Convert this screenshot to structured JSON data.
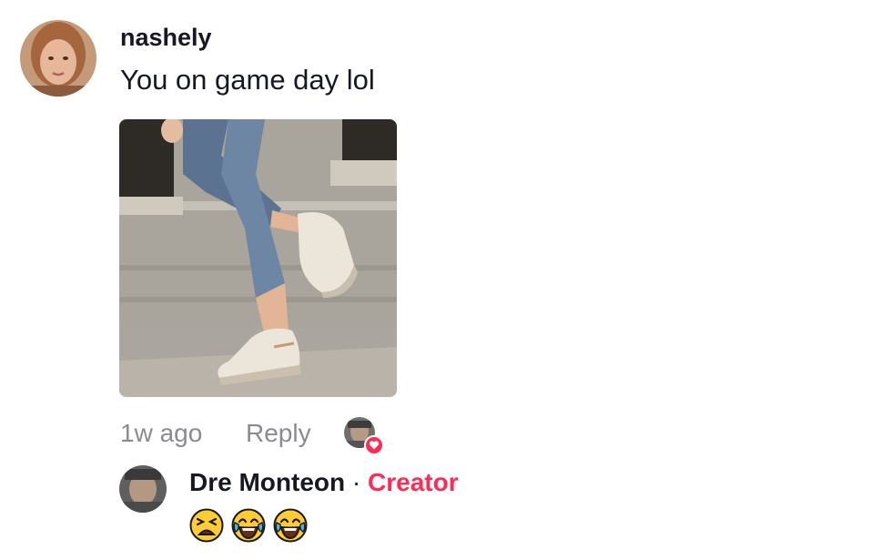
{
  "comment": {
    "username": "nashely",
    "text": "You on game day lol",
    "time": "1w ago",
    "reply_label": "Reply",
    "liked_by_creator": true
  },
  "reply": {
    "author": "Dre Monteon",
    "separator": "·",
    "badge": "Creator",
    "emojis": [
      "tired-face-emoji",
      "joy-emoji",
      "joy-emoji"
    ]
  },
  "colors": {
    "text_primary": "#161823",
    "text_secondary": "#8a8b91",
    "creator_accent": "#fe2c55"
  }
}
